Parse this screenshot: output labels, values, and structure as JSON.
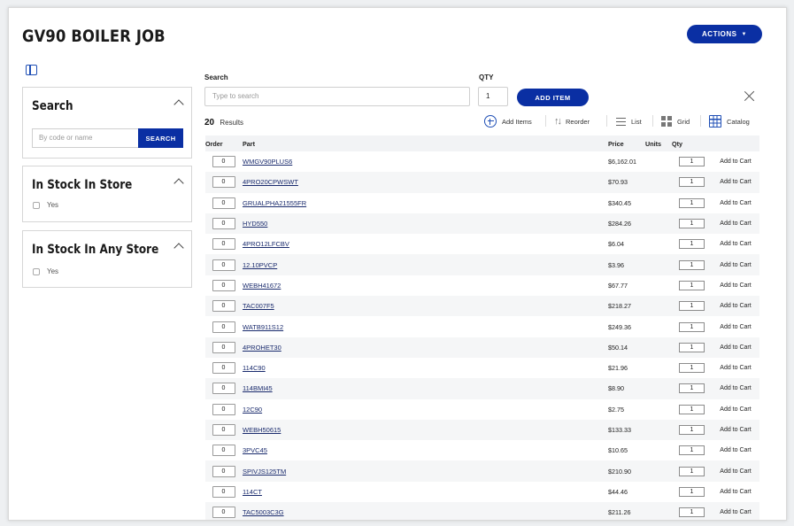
{
  "page": {
    "title": "GV90 BOILER JOB",
    "actions_label": "ACTIONS",
    "accent_color": "#0a2fa3"
  },
  "sidebar": {
    "search": {
      "title": "Search",
      "placeholder": "By code or name",
      "button_label": "SEARCH"
    },
    "in_stock_store": {
      "title": "In Stock In Store",
      "option": "Yes"
    },
    "in_stock_any": {
      "title": "In Stock In Any Store",
      "option": "Yes"
    }
  },
  "search_bar": {
    "search_label": "Search",
    "search_placeholder": "Type to search",
    "qty_label": "QTY",
    "qty_value": "1",
    "add_item_label": "ADD ITEM"
  },
  "results": {
    "count": "20",
    "label": "Results"
  },
  "toolbar": {
    "add_items": "Add Items",
    "reorder": "Reorder",
    "list": "List",
    "grid": "Grid",
    "catalog": "Catalog"
  },
  "table": {
    "headers": {
      "order": "Order",
      "part": "Part",
      "price": "Price",
      "units": "Units",
      "qty": "Qty"
    },
    "add_to_cart_label": "Add to Cart",
    "rows": [
      {
        "order": "0",
        "part": "WMGV90PLUS6",
        "price": "$6,162.01",
        "units": "",
        "qty": "1"
      },
      {
        "order": "0",
        "part": "4PRO20CPWSWT",
        "price": "$70.93",
        "units": "",
        "qty": "1"
      },
      {
        "order": "0",
        "part": "GRUALPHA21555FR",
        "price": "$340.45",
        "units": "",
        "qty": "1"
      },
      {
        "order": "0",
        "part": "HYD550",
        "price": "$284.26",
        "units": "",
        "qty": "1"
      },
      {
        "order": "0",
        "part": "4PRO12LFCBV",
        "price": "$6.04",
        "units": "",
        "qty": "1"
      },
      {
        "order": "0",
        "part": "12.10PVCP",
        "price": "$3.96",
        "units": "",
        "qty": "1"
      },
      {
        "order": "0",
        "part": "WEBH41672",
        "price": "$67.77",
        "units": "",
        "qty": "1"
      },
      {
        "order": "0",
        "part": "TAC007F5",
        "price": "$218.27",
        "units": "",
        "qty": "1"
      },
      {
        "order": "0",
        "part": "WATB911S12",
        "price": "$249.36",
        "units": "",
        "qty": "1"
      },
      {
        "order": "0",
        "part": "4PROHET30",
        "price": "$50.14",
        "units": "",
        "qty": "1"
      },
      {
        "order": "0",
        "part": "114C90",
        "price": "$21.96",
        "units": "",
        "qty": "1"
      },
      {
        "order": "0",
        "part": "114BMI45",
        "price": "$8.90",
        "units": "",
        "qty": "1"
      },
      {
        "order": "0",
        "part": "12C90",
        "price": "$2.75",
        "units": "",
        "qty": "1"
      },
      {
        "order": "0",
        "part": "WEBH50615",
        "price": "$133.33",
        "units": "",
        "qty": "1"
      },
      {
        "order": "0",
        "part": "3PVC45",
        "price": "$10.65",
        "units": "",
        "qty": "1"
      },
      {
        "order": "0",
        "part": "SPIVJS125TM",
        "price": "$210.90",
        "units": "",
        "qty": "1"
      },
      {
        "order": "0",
        "part": "114CT",
        "price": "$44.46",
        "units": "",
        "qty": "1"
      },
      {
        "order": "0",
        "part": "TAC5003C3G",
        "price": "$211.26",
        "units": "",
        "qty": "1"
      }
    ]
  }
}
